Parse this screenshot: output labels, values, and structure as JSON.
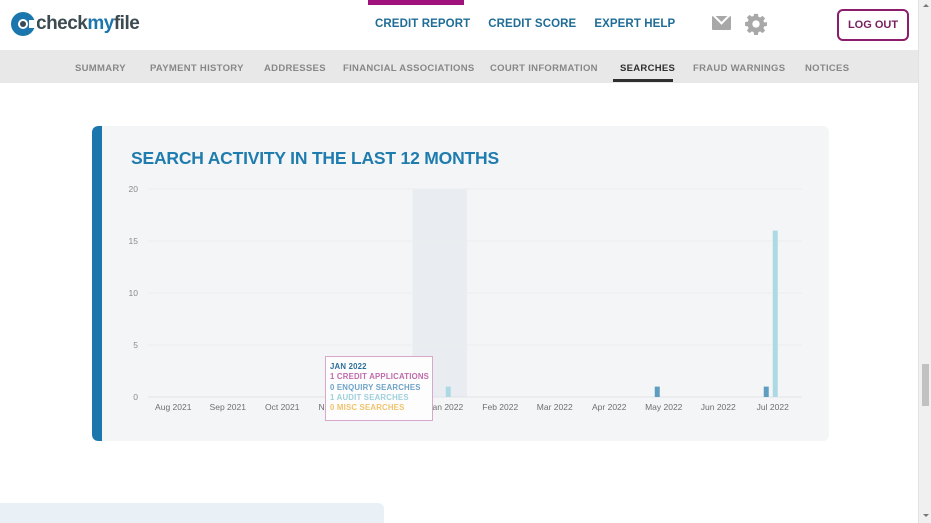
{
  "brand": {
    "logo_check": "check",
    "logo_my": "my",
    "logo_file": "file",
    "accent_color": "#a0127b",
    "primary_color": "#1a76ad"
  },
  "topnav": [
    {
      "label": "CREDIT REPORT",
      "active": true
    },
    {
      "label": "CREDIT SCORE",
      "active": false
    },
    {
      "label": "EXPERT HELP",
      "active": false
    }
  ],
  "header_icons": {
    "mail": "mail-icon",
    "settings": "gear-icon"
  },
  "logout_label": "LOG OUT",
  "subnav": [
    {
      "label": "SUMMARY",
      "active": false
    },
    {
      "label": "PAYMENT HISTORY",
      "active": false
    },
    {
      "label": "ADDRESSES",
      "active": false
    },
    {
      "label": "FINANCIAL ASSOCIATIONS",
      "active": false
    },
    {
      "label": "COURT INFORMATION",
      "active": false
    },
    {
      "label": "SEARCHES",
      "active": true
    },
    {
      "label": "FRAUD WARNINGS",
      "active": false
    },
    {
      "label": "NOTICES",
      "active": false
    }
  ],
  "card": {
    "title": "SEARCH ACTIVITY IN THE LAST 12 MONTHS"
  },
  "tooltip": {
    "month": "JAN 2022",
    "lines": [
      {
        "text": "1 CREDIT APPLICATIONS",
        "color": "#c06aab"
      },
      {
        "text": "0 ENQUIRY SEARCHES",
        "color": "#6ea3c7"
      },
      {
        "text": "1 AUDIT SEARCHES",
        "color": "#9fd0dc"
      },
      {
        "text": "0 MISC SEARCHES",
        "color": "#f0c36a"
      }
    ],
    "month_color": "#2a6f9b"
  },
  "chart_data": {
    "type": "bar",
    "title": "SEARCH ACTIVITY IN THE LAST 12 MONTHS",
    "xlabel": "",
    "ylabel": "",
    "ylim": [
      0,
      20
    ],
    "yticks": [
      "0",
      "5",
      "10",
      "15",
      "20"
    ],
    "grid": true,
    "categories": [
      "Aug 2021",
      "Sep 2021",
      "Oct 2021",
      "Nov 2021",
      "Dec 2021",
      "Jan 2022",
      "Feb 2022",
      "Mar 2022",
      "Apr 2022",
      "May 2022",
      "Jun 2022",
      "Jul 2022"
    ],
    "highlighted_category": "Jan 2022",
    "series": [
      {
        "name": "Credit applications",
        "color": "#d77fbf",
        "values": [
          0,
          0,
          0,
          0,
          0,
          1,
          0,
          0,
          0,
          0,
          0,
          0
        ]
      },
      {
        "name": "Enquiry searches",
        "color": "#5e9dbf",
        "values": [
          0,
          0,
          0,
          0,
          0,
          0,
          0,
          0,
          0,
          1,
          0,
          1
        ]
      },
      {
        "name": "Audit searches",
        "color": "#add9e4",
        "values": [
          0,
          0,
          0,
          0,
          0,
          1,
          0,
          0,
          0,
          0,
          0,
          16
        ]
      },
      {
        "name": "Misc searches",
        "color": "#f0c36a",
        "values": [
          0,
          0,
          0,
          0,
          0,
          0,
          0,
          0,
          0,
          0,
          0,
          0
        ]
      }
    ]
  }
}
